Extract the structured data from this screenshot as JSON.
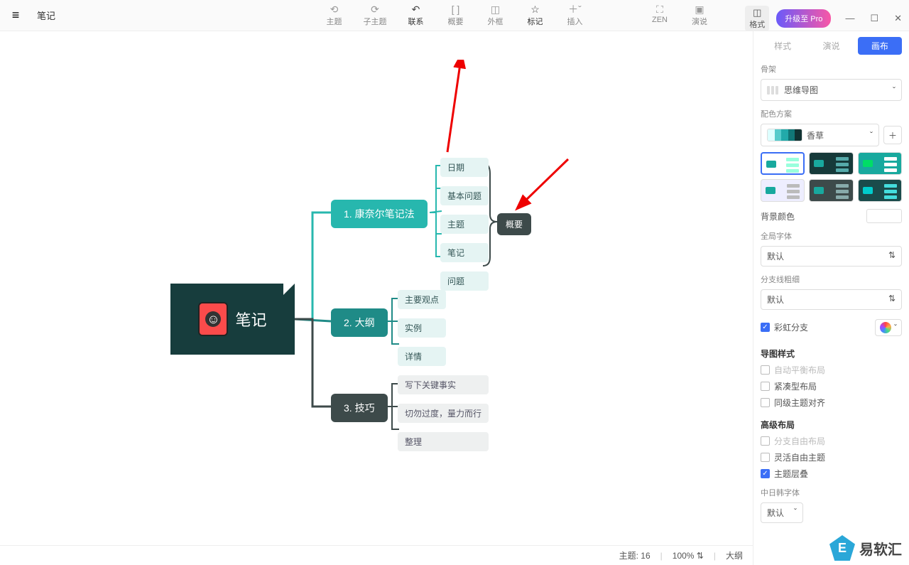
{
  "doc_title": "笔记",
  "toolbar": {
    "center": [
      {
        "icon": "⟵⊞",
        "label": "主题"
      },
      {
        "icon": "⟶⊞",
        "label": "子主题"
      },
      {
        "icon": "↶",
        "label": "联系",
        "active": true
      },
      {
        "icon": "[ ]",
        "label": "概要"
      },
      {
        "icon": "◫",
        "label": "外框"
      },
      {
        "icon": "☆",
        "label": "标记",
        "active": true
      },
      {
        "icon": "＋ˇ",
        "label": "插入"
      }
    ],
    "right": [
      {
        "icon": "⛶",
        "label": "ZEN"
      },
      {
        "icon": "▷",
        "label": "演说"
      }
    ],
    "format": {
      "icon": "◫",
      "label": "格式"
    },
    "upgrade": "升级至 Pro"
  },
  "mindmap": {
    "root": "笔记",
    "branches": [
      {
        "title": "1. 康奈尔笔记法",
        "leaves": [
          "日期",
          "基本问题",
          "主题",
          "笔记",
          "问题"
        ]
      },
      {
        "title": "2. 大纲",
        "leaves": [
          "主要观点",
          "实例",
          "详情"
        ]
      },
      {
        "title": "3. 技巧",
        "leaves": [
          "写下关键事实",
          "切勿过度，量力而行",
          "整理"
        ]
      }
    ],
    "summary": "概要"
  },
  "rpanel": {
    "tabs": [
      "样式",
      "演说",
      "画布"
    ],
    "active_tab": 2,
    "skeleton_label": "骨架",
    "skeleton_value": "思维导图",
    "color_scheme_label": "配色方案",
    "color_scheme_value": "香草",
    "bg_label": "背景颜色",
    "global_font_label": "全局字体",
    "global_font_value": "默认",
    "branch_width_label": "分支线粗细",
    "branch_width_value": "默认",
    "rainbow_label": "彩虹分支",
    "map_style_head": "导图样式",
    "opt_auto_balance": "自动平衡布局",
    "opt_compact": "紧凑型布局",
    "opt_align_sibling": "同级主题对齐",
    "adv_layout_head": "高级布局",
    "opt_free_branch": "分支自由布局",
    "opt_free_topic": "灵活自由主题",
    "opt_overlap": "主题层叠",
    "cjk_label": "中日韩字体",
    "cjk_value": "默认"
  },
  "statusbar": {
    "topic_count_label": "主题:",
    "topic_count": "16",
    "zoom": "100%",
    "outline": "大纲"
  },
  "watermark": "易软汇"
}
